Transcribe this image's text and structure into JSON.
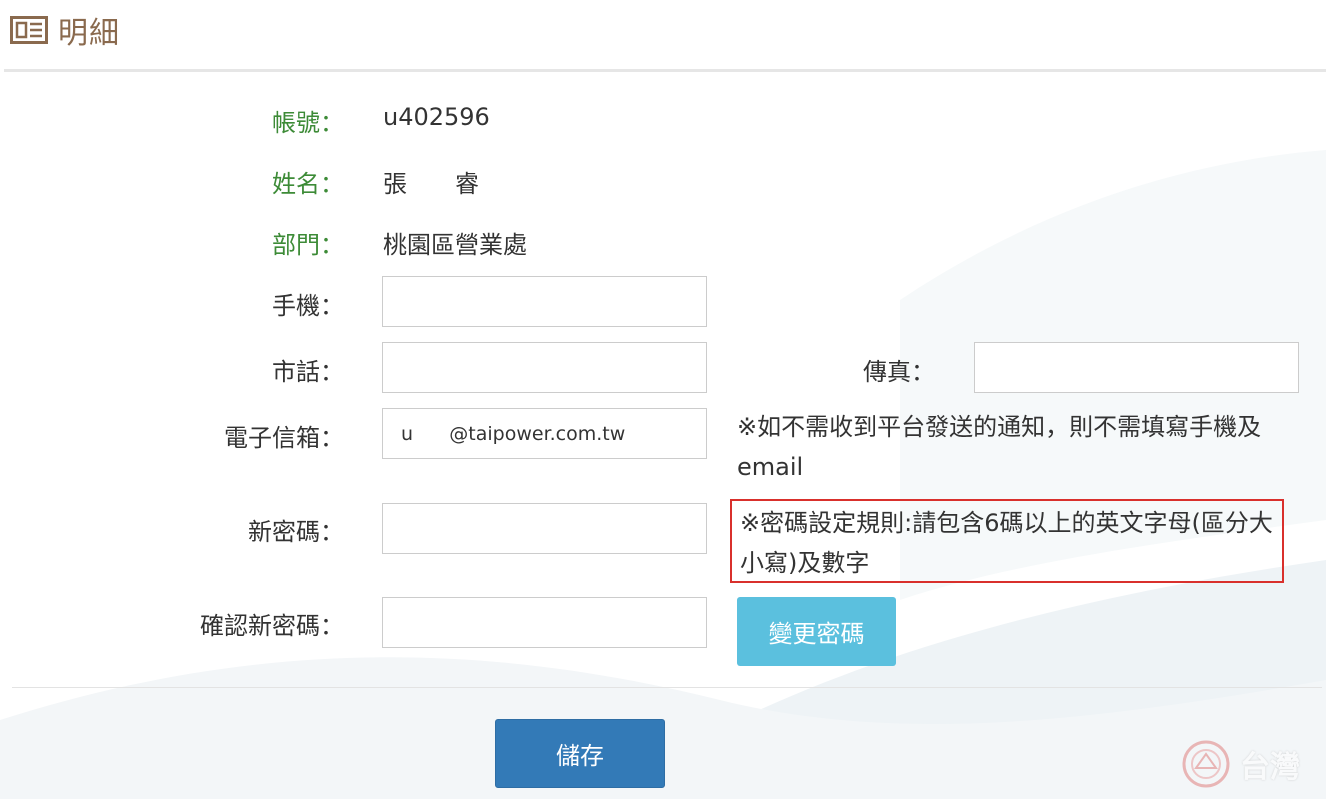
{
  "header": {
    "title": "明細"
  },
  "account": {
    "label": "帳號：",
    "value": "u402596"
  },
  "name": {
    "label": "姓名：",
    "value": "張　　睿"
  },
  "department": {
    "label": "部門：",
    "value": "桃園區營業處"
  },
  "mobile": {
    "label": "手機：",
    "value": ""
  },
  "phone": {
    "label": "市話：",
    "value": ""
  },
  "fax": {
    "label": "傳真：",
    "value": ""
  },
  "email": {
    "label": "電子信箱：",
    "value": "u      @taipower.com.tw"
  },
  "email_note": "※如不需收到平台發送的通知，則不需填寫手機及email",
  "new_password": {
    "label": "新密碼：",
    "value": ""
  },
  "password_rule": "※密碼設定規則:請包含6碼以上的英文字母(區分大小寫)及數字",
  "confirm_password": {
    "label": "確認新密碼：",
    "value": ""
  },
  "buttons": {
    "change_password": "變更密碼",
    "save": "儲存"
  },
  "watermark": {
    "text": "台灣"
  },
  "colors": {
    "label_green": "#3d8b37",
    "title_brown": "#8a6a4e",
    "info_button": "#5bc0de",
    "primary_button": "#337ab7",
    "alert_border": "#d9302c"
  }
}
